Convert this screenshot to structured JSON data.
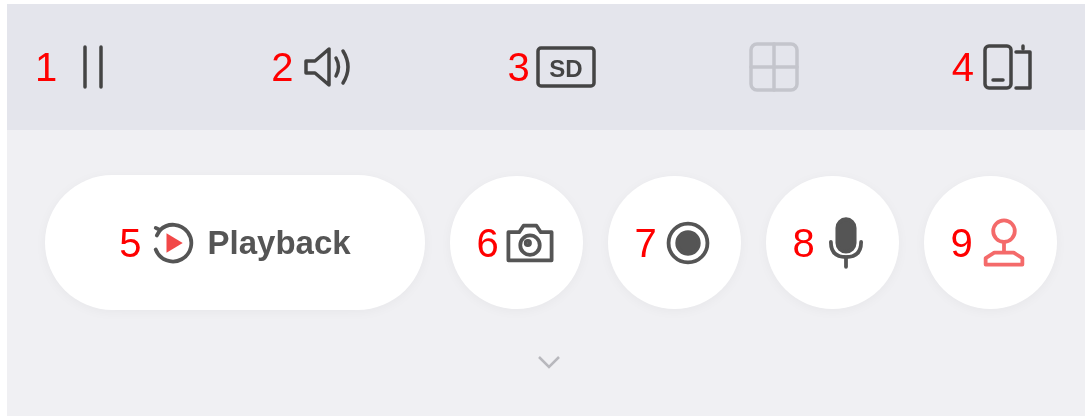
{
  "top_bar": {
    "items": [
      {
        "kind": "pause",
        "marker": "1",
        "disabled": false
      },
      {
        "kind": "sound",
        "marker": "2",
        "disabled": false
      },
      {
        "kind": "sd",
        "marker": "3",
        "text": "SD",
        "disabled": false
      },
      {
        "kind": "grid",
        "disabled": true
      },
      {
        "kind": "device",
        "marker": "4",
        "disabled": false
      }
    ]
  },
  "controls": [
    {
      "kind": "playback",
      "marker": "5",
      "label": "Playback",
      "highlighted": false
    },
    {
      "kind": "camera",
      "marker": "6",
      "highlighted": false
    },
    {
      "kind": "record",
      "marker": "7",
      "highlighted": false
    },
    {
      "kind": "mic",
      "marker": "8",
      "highlighted": false
    },
    {
      "kind": "person",
      "marker": "9",
      "highlighted": true
    }
  ],
  "expand": {
    "expanded": false
  }
}
